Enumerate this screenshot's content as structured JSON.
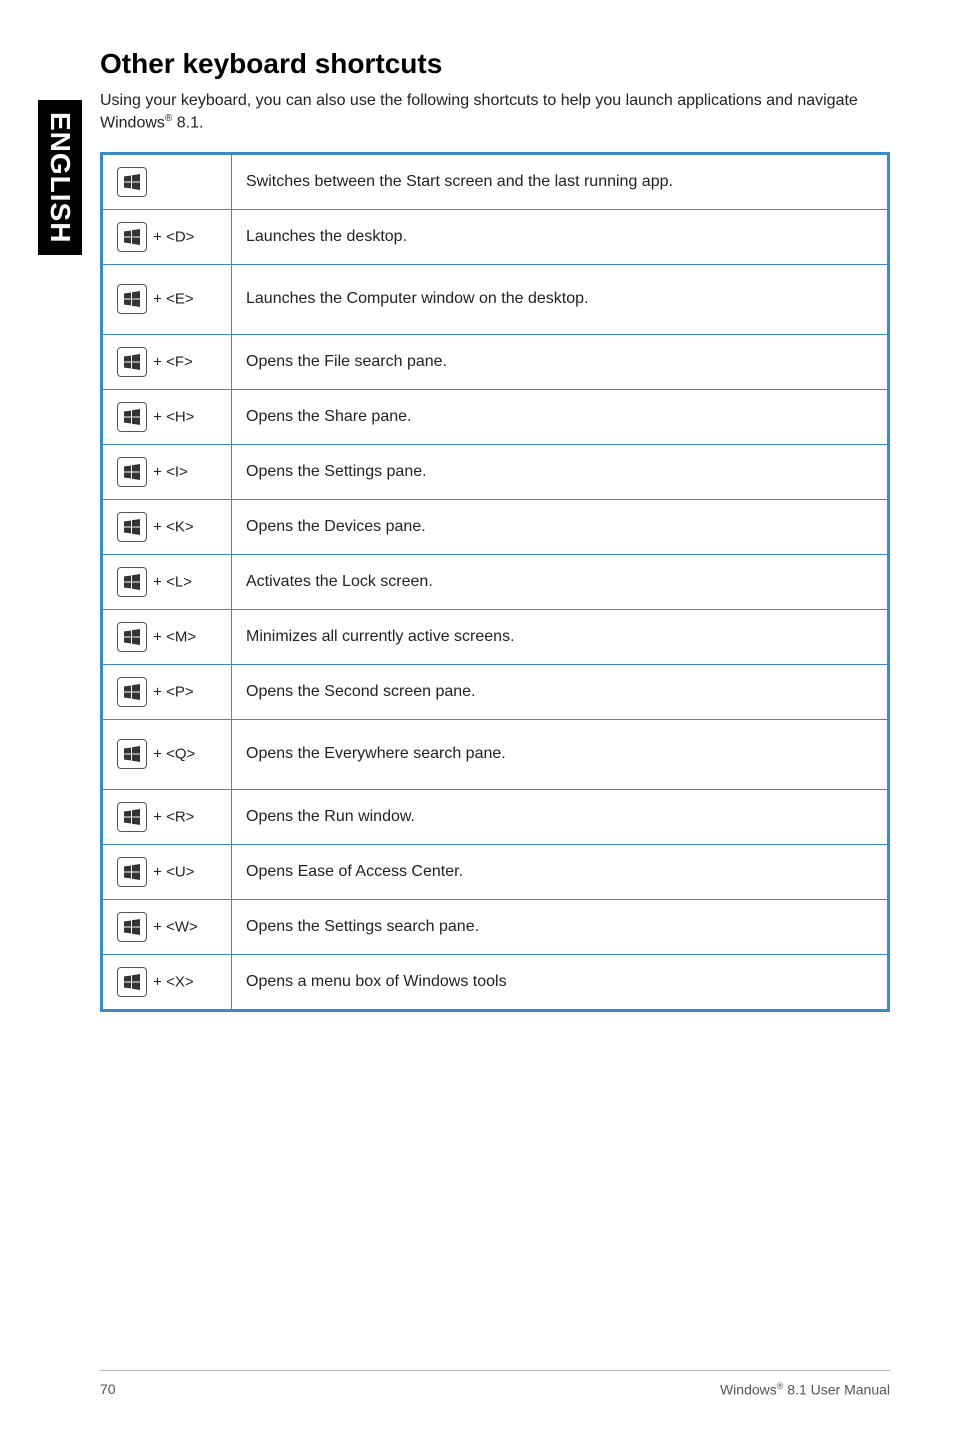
{
  "side_tab": "ENGLISH",
  "heading": "Other keyboard shortcuts",
  "intro_before": "Using your keyboard, you can also use the following shortcuts to help you launch applications and navigate Windows",
  "intro_after": " 8.1.",
  "reg": "®",
  "rows": [
    {
      "combo": "",
      "desc": "Switches between the Start screen and the last running app."
    },
    {
      "combo": " + <D>",
      "desc": "Launches the desktop."
    },
    {
      "combo": " + <E>",
      "desc": "Launches the Computer window on the desktop."
    },
    {
      "combo": " + <F>",
      "desc": "Opens the File search pane."
    },
    {
      "combo": " + <H>",
      "desc": "Opens the Share pane."
    },
    {
      "combo": " + <I>",
      "desc": "Opens the Settings pane."
    },
    {
      "combo": " + <K>",
      "desc": "Opens the Devices pane."
    },
    {
      "combo": " + <L>",
      "desc": "Activates the Lock screen."
    },
    {
      "combo": " + <M>",
      "desc": "Minimizes all currently active screens."
    },
    {
      "combo": " + <P>",
      "desc": "Opens the Second screen pane."
    },
    {
      "combo": " + <Q>",
      "desc": "Opens the Everywhere search pane."
    },
    {
      "combo": " + <R>",
      "desc": "Opens the Run window."
    },
    {
      "combo": " + <U>",
      "desc": "Opens Ease of Access Center."
    },
    {
      "combo": " + <W>",
      "desc": "Opens the Settings search pane."
    },
    {
      "combo": " + <X>",
      "desc": "Opens a menu box of Windows tools"
    }
  ],
  "footer": {
    "page": "70",
    "manual_before": "Windows",
    "manual_after": " 8.1 User Manual"
  }
}
